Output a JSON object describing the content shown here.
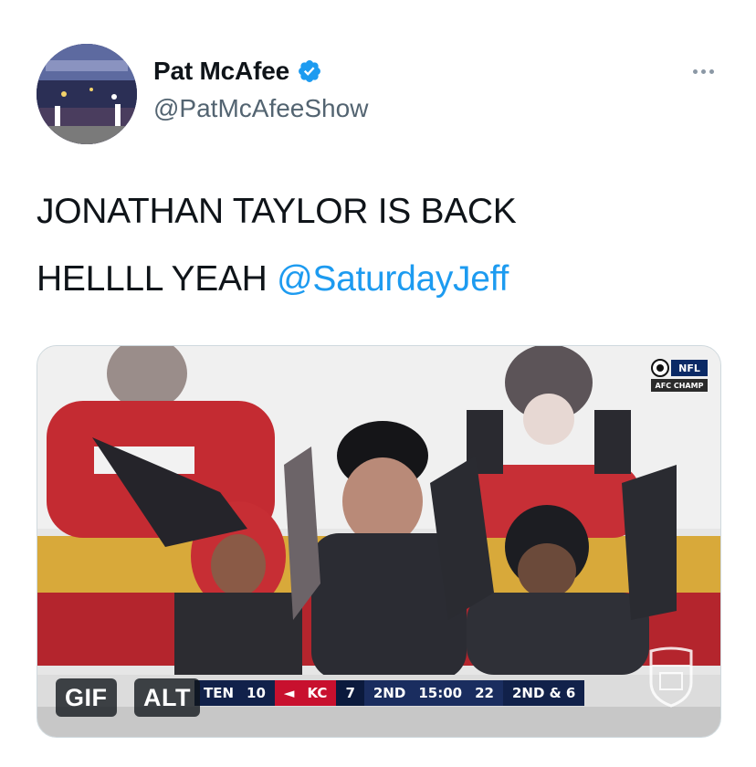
{
  "tweet": {
    "display_name": "Pat McAfee",
    "handle": "@PatMcAfeeShow",
    "verified_icon": "verified-badge-icon",
    "more_icon": "more-options-icon",
    "text_line1": "JONATHAN TAYLOR IS BACK",
    "text_line2_prefix": "HELLLL YEAH ",
    "mention": "@SaturdayJeff"
  },
  "media": {
    "gif_label": "GIF",
    "alt_label": "ALT",
    "network_bug": {
      "top_text": "NFL",
      "bottom_text": "AFC CHAMP"
    },
    "scoreboard": {
      "team1": "TEN",
      "score1": "10",
      "team2": "KC",
      "score2": "7",
      "quarter": "2ND",
      "clock": "15:00",
      "play_clock": "22",
      "down_distance": "2ND & 6"
    },
    "watermark_icon": "nfl-shield-icon"
  },
  "colors": {
    "accent": "#1d9bf0",
    "text": "#0f1419",
    "secondary_text": "#536471",
    "chiefs_red": "#c8102e"
  }
}
